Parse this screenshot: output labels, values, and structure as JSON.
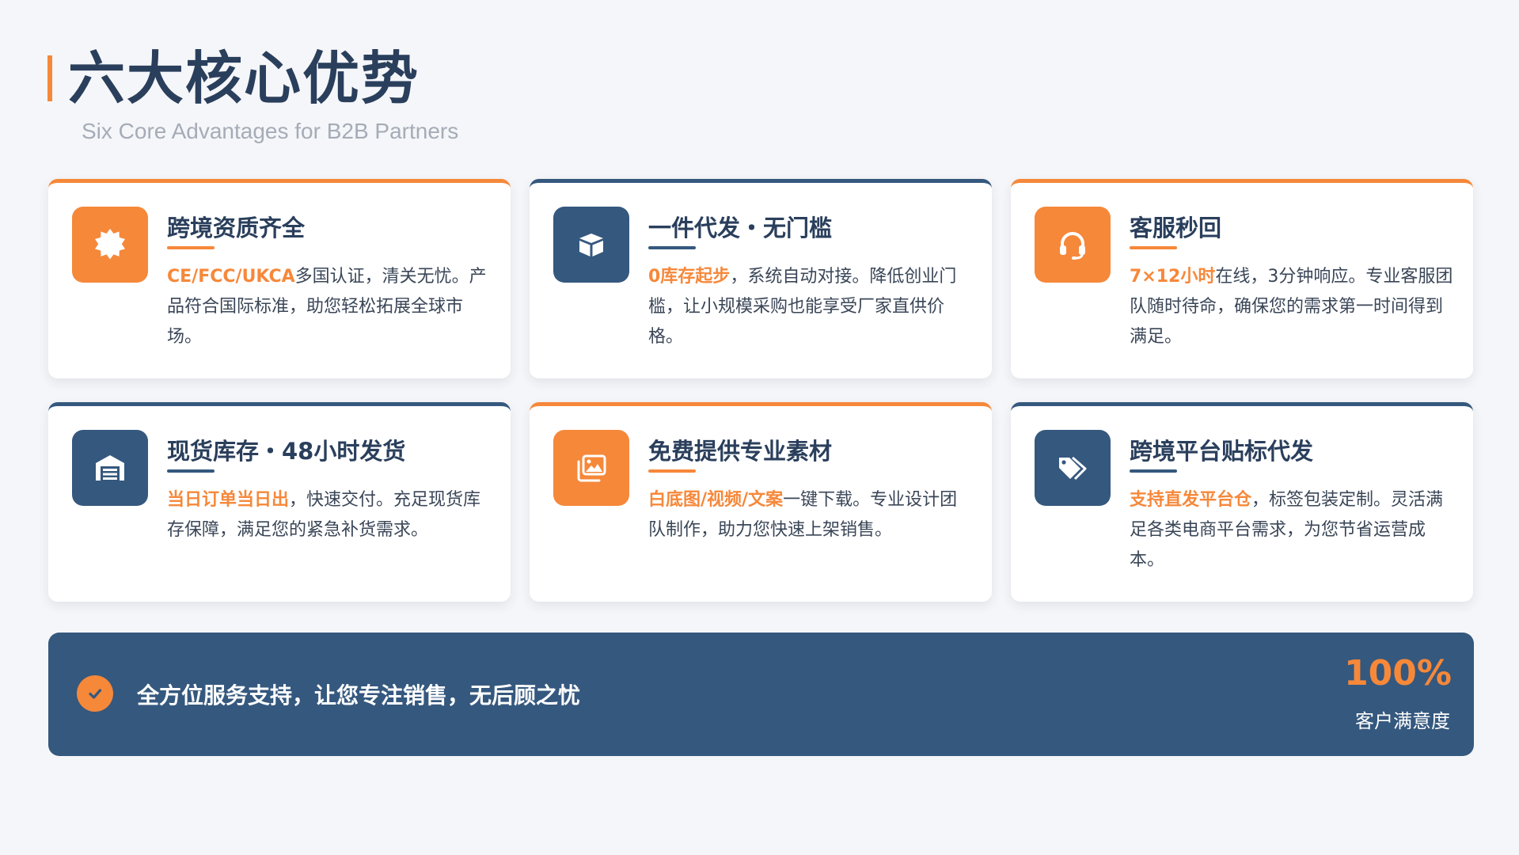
{
  "header": {
    "title": "六大核心优势",
    "subtitle": "Six Core Advantages for B2B Partners"
  },
  "colors": {
    "accent": "#f6883a",
    "navy": "#35587e",
    "title": "#2a3f5c",
    "background": "#f5f6f9"
  },
  "cards": [
    {
      "title": "跨境资质齐全",
      "highlight": "CE/FCC/UKCA",
      "text": "多国认证，清关无忧。产品符合国际标准，助您轻松拓展全球市场。",
      "icon": "badge-icon",
      "theme": "orange"
    },
    {
      "title": "一件代发・无门槛",
      "highlight": "0库存起步",
      "text": "，系统自动对接。降低创业门槛，让小规模采购也能享受厂家直供价格。",
      "icon": "box-icon",
      "theme": "navy"
    },
    {
      "title": "客服秒回",
      "highlight": "7×12小时",
      "text": "在线，3分钟响应。专业客服团队随时待命，确保您的需求第一时间得到满足。",
      "icon": "headset-icon",
      "theme": "orange"
    },
    {
      "title": "现货库存・48小时发货",
      "highlight": "当日订单当日出",
      "text": "，快速交付。充足现货库存保障，满足您的紧急补货需求。",
      "icon": "warehouse-icon",
      "theme": "navy"
    },
    {
      "title": "免费提供专业素材",
      "highlight": "白底图/视频/文案",
      "text": "一键下载。专业设计团队制作，助力您快速上架销售。",
      "icon": "images-icon",
      "theme": "orange"
    },
    {
      "title": "跨境平台贴标代发",
      "highlight": "支持直发平台仓",
      "text": "，标签包装定制。灵活满足各类电商平台需求，为您节省运营成本。",
      "icon": "tags-icon",
      "theme": "navy"
    }
  ],
  "banner": {
    "text": "全方位服务支持，让您专注销售，无后顾之忧",
    "stat_value": "100%",
    "stat_label": "客户满意度",
    "icon": "check-circle-icon"
  }
}
